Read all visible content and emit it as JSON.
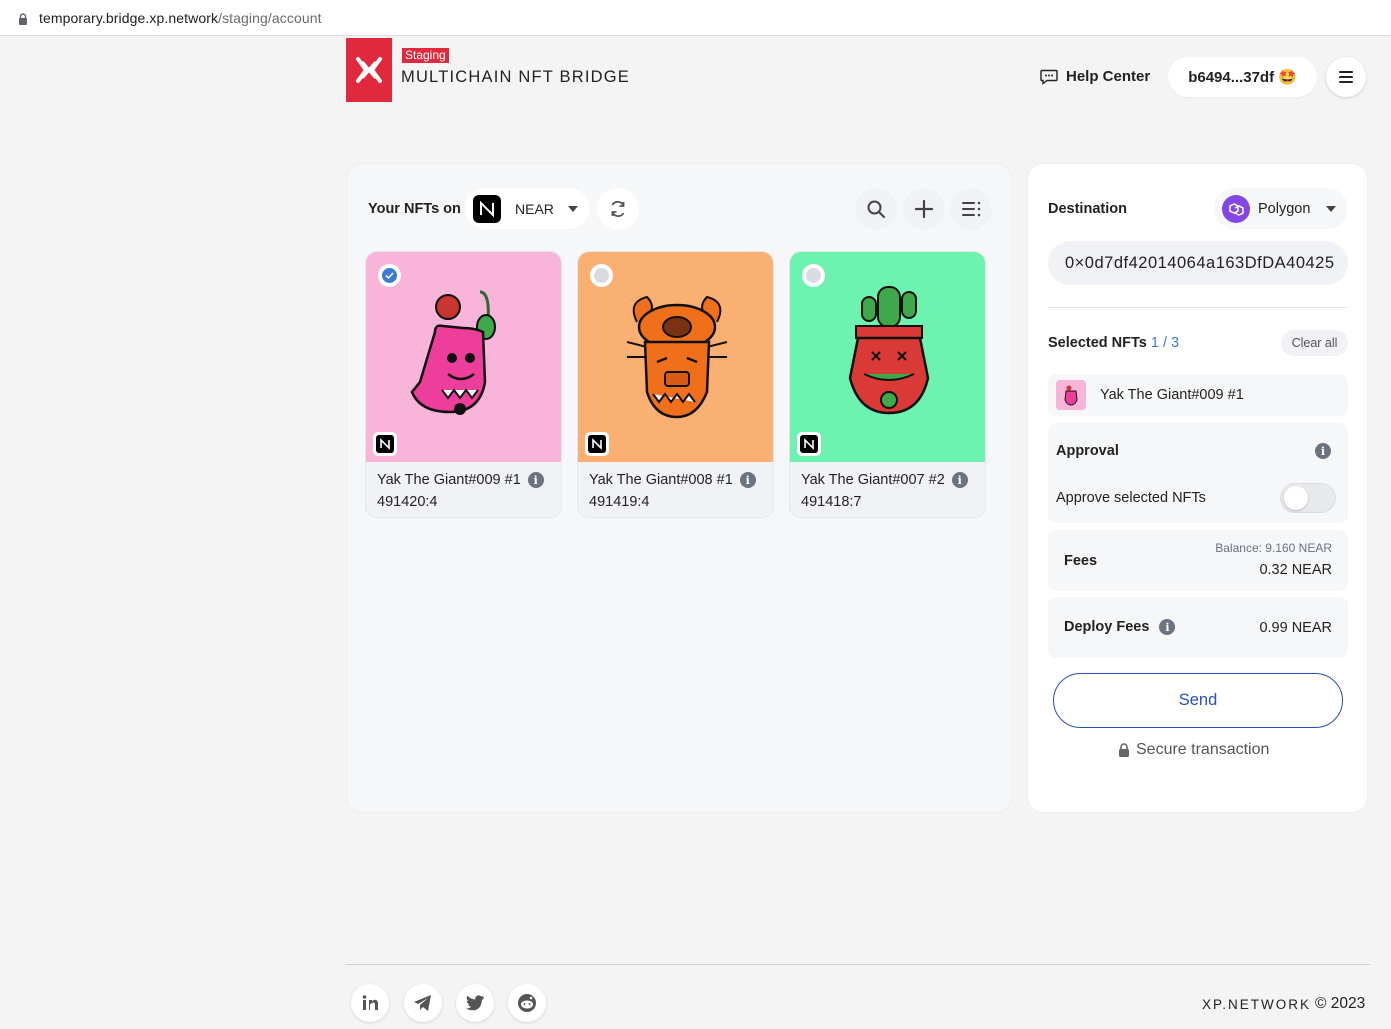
{
  "browser": {
    "url_host": "temporary.bridge.xp.network",
    "url_path": "/staging/account"
  },
  "header": {
    "staging_badge": "Staging",
    "brand": "MULTICHAIN NFT BRIDGE",
    "help_center": "Help Center",
    "wallet_address": "b6494...37df",
    "wallet_emoji": "🤩"
  },
  "nft_panel": {
    "label": "Your NFTs on",
    "chain": "NEAR",
    "nfts": [
      {
        "name": "Yak The Giant#009 #1",
        "id": "491420:4",
        "bg": "#f8b4d9",
        "selected": true
      },
      {
        "name": "Yak The Giant#008 #1",
        "id": "491419:4",
        "bg": "#fbb073",
        "selected": false
      },
      {
        "name": "Yak The Giant#007 #2",
        "id": "491418:7",
        "bg": "#6ef2b0",
        "selected": false
      }
    ]
  },
  "transfer_panel": {
    "destination_label": "Destination",
    "destination_chain": "Polygon",
    "address": "0×0d7df42014064a163DfDA40425",
    "selected_label": "Selected NFTs",
    "selected_count": "1 / 3",
    "clear_all": "Clear all",
    "selected_item": "Yak The Giant#009 #1",
    "approval_title": "Approval",
    "approve_label": "Approve selected NFTs",
    "fees_label": "Fees",
    "balance": "Balance: 9.160 NEAR",
    "fees_value": "0.32 NEAR",
    "deploy_label": "Deploy Fees",
    "deploy_value": "0.99 NEAR",
    "send": "Send",
    "secure": "Secure transaction"
  },
  "footer": {
    "brand": "XP.NETWORK",
    "copyright": "© 2023",
    "social": [
      "linkedin-icon",
      "telegram-icon",
      "twitter-icon",
      "reddit-icon"
    ]
  },
  "colors": {
    "accent_red": "#e0293c",
    "accent_blue": "#2a4fbf",
    "polygon_purple": "#8247e5"
  }
}
